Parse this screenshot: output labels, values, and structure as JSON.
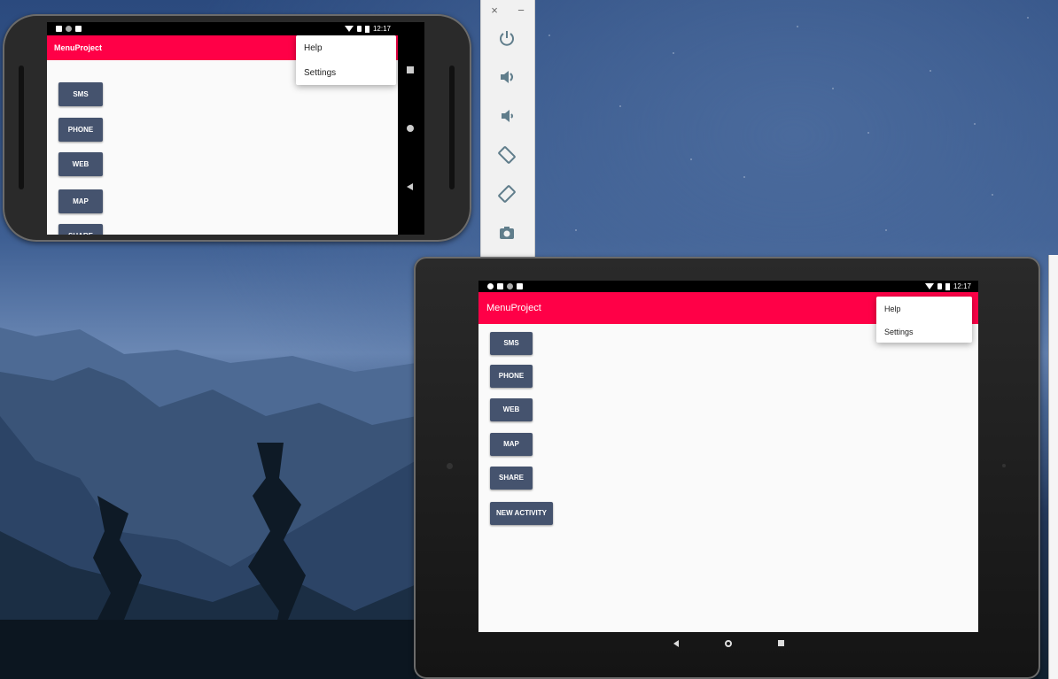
{
  "app": {
    "title": "MenuProject",
    "accent": "#ff0047",
    "button_color": "#45536e"
  },
  "phone": {
    "status_time": "12:17",
    "buttons": [
      "SMS",
      "PHONE",
      "WEB",
      "MAP",
      "SHARE"
    ],
    "menu": [
      "Help",
      "Settings"
    ]
  },
  "tablet": {
    "status_time": "12:17",
    "buttons": [
      "SMS",
      "PHONE",
      "WEB",
      "MAP",
      "SHARE",
      "NEW ACTIVITY"
    ],
    "menu": [
      "Help",
      "Settings"
    ]
  },
  "emulator_toolbar": {
    "header": [
      "×",
      "−"
    ],
    "tools": [
      "power-icon",
      "volume-up-icon",
      "volume-down-icon",
      "rotate-left-icon",
      "rotate-right-icon",
      "camera-icon"
    ]
  }
}
